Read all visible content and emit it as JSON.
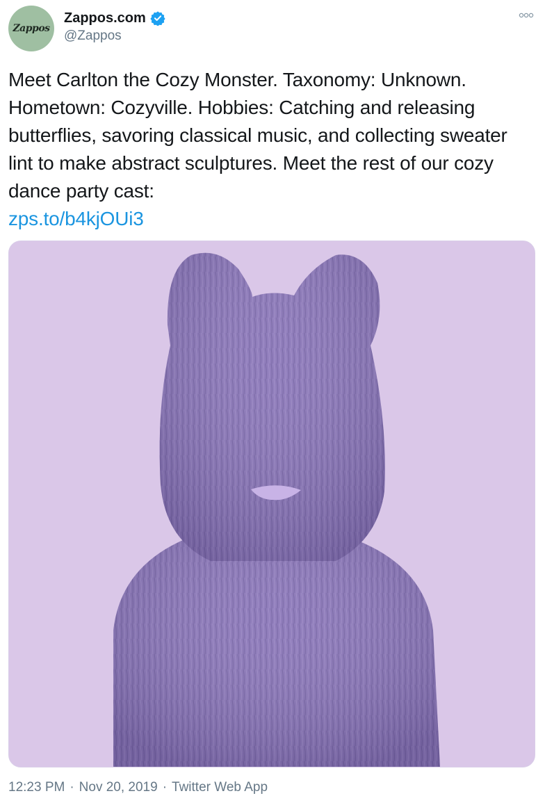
{
  "author": {
    "avatar_text": "Zappos",
    "display_name": "Zappos.com",
    "handle": "@Zappos",
    "verified": true
  },
  "tweet": {
    "text": "Meet Carlton the Cozy Monster. Taxonomy: Unknown. Hometown: Cozyville. Hobbies: Catching and releasing butterflies, savoring classical music, and collecting sweater lint to make abstract sculptures. Meet the rest of our cozy dance party cast:",
    "link": "zps.to/b4kjOUi3"
  },
  "media": {
    "background_color": "#dac7e8",
    "subject_color": "#8a76b8"
  },
  "meta": {
    "time": "12:23 PM",
    "separator": "·",
    "date": "Nov 20, 2019",
    "source": "Twitter Web App"
  },
  "colors": {
    "link": "#1b95e0",
    "secondary_text": "#657786",
    "verified": "#1da1f2"
  },
  "icons": {
    "verified": "verified-badge-icon",
    "more": "more-options-icon"
  }
}
